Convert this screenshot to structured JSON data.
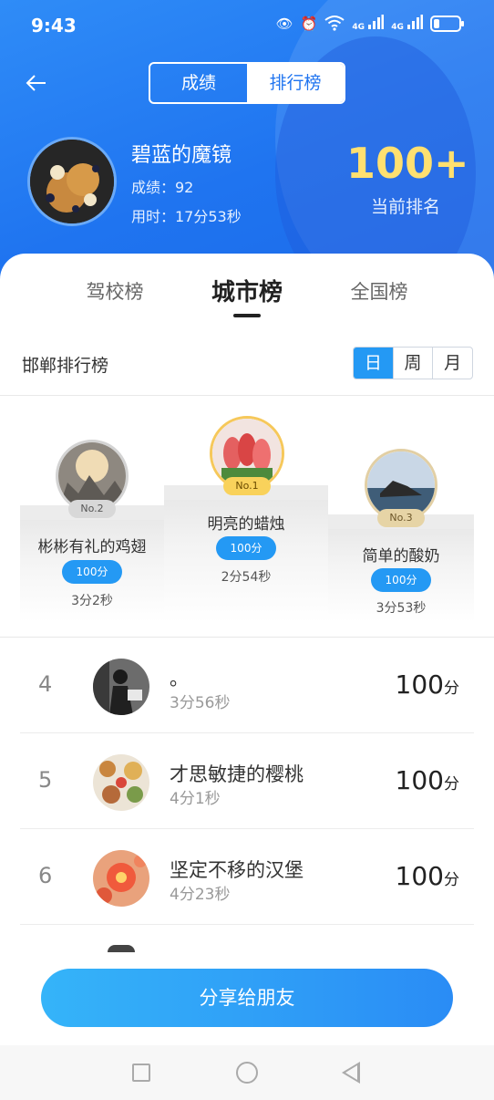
{
  "status_bar": {
    "time": "9:43",
    "net1": "4G",
    "net2": "4G"
  },
  "header": {
    "seg_tabs": [
      "成绩",
      "排行榜"
    ],
    "active_seg": "排行榜"
  },
  "user": {
    "name": "碧蓝的魔镜",
    "score_line": "成绩：92",
    "time_line": "用时：17分53秒",
    "rank": "100+",
    "rank_label": "当前排名"
  },
  "tabs": [
    "驾校榜",
    "城市榜",
    "全国榜"
  ],
  "active_tab": "城市榜",
  "board": {
    "title": "邯郸排行榜",
    "periods": [
      "日",
      "周",
      "月"
    ],
    "active_period": "日"
  },
  "podium": [
    {
      "place": "No.2",
      "name": "彬彬有礼的鸡翅",
      "score": "100分",
      "time": "3分2秒"
    },
    {
      "place": "No.1",
      "name": "明亮的蜡烛",
      "score": "100分",
      "time": "2分54秒"
    },
    {
      "place": "No.3",
      "name": "简单的酸奶",
      "score": "100分",
      "time": "3分53秒"
    }
  ],
  "list": [
    {
      "rank": "4",
      "name": "。",
      "time": "3分56秒",
      "score": "100",
      "unit": "分"
    },
    {
      "rank": "5",
      "name": "才思敏捷的樱桃",
      "time": "4分1秒",
      "score": "100",
      "unit": "分"
    },
    {
      "rank": "6",
      "name": "坚定不移的汉堡",
      "time": "4分23秒",
      "score": "100",
      "unit": "分"
    }
  ],
  "share_label": "分享给朋友",
  "colors": {
    "primary": "#1f74f0",
    "accent_blue": "#2499f4",
    "gold": "#ffe070"
  }
}
